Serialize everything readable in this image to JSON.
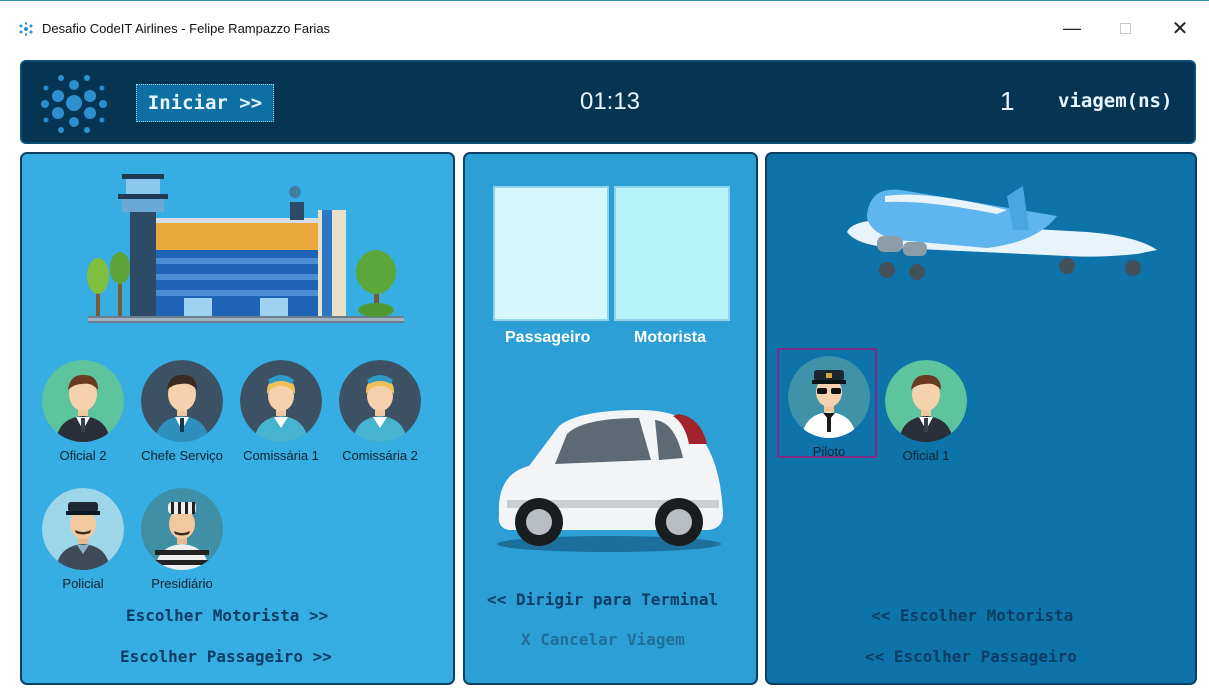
{
  "window": {
    "title": "Desafio CodeIT Airlines - Felipe Rampazzo Farias",
    "controls": {
      "minimize": "—",
      "close": "✕"
    }
  },
  "header": {
    "start_label": "Iniciar >>",
    "timer": "01:13",
    "trip_count": "1",
    "trip_label": "viagem(ns)"
  },
  "terminal": {
    "people": [
      {
        "name": "Oficial 2"
      },
      {
        "name": "Chefe Serviço"
      },
      {
        "name": "Comissária 1"
      },
      {
        "name": "Comissária 2"
      },
      {
        "name": "Policial"
      },
      {
        "name": "Presidiário"
      }
    ],
    "choose_driver": "Escolher Motorista >>",
    "choose_passenger": "Escolher Passageiro >>"
  },
  "vehicle": {
    "passenger_label": "Passageiro",
    "driver_label": "Motorista",
    "drive_to_terminal": "<< Dirigir para Terminal",
    "cancel_trip": "X Cancelar Viagem"
  },
  "airplane": {
    "people": [
      {
        "name": "Piloto",
        "selected": true
      },
      {
        "name": "Oficial 1"
      }
    ],
    "choose_driver": "<< Escolher Motorista",
    "choose_passenger": "<< Escolher Passageiro"
  },
  "colors": {
    "header_bg": "#063553",
    "terminal_bg": "#36aee3",
    "vehicle_bg": "#2b9fd6",
    "airplane_bg": "#0d73a8",
    "selection": "#7c2b8c",
    "disabled_text": "#1f6f9a"
  }
}
